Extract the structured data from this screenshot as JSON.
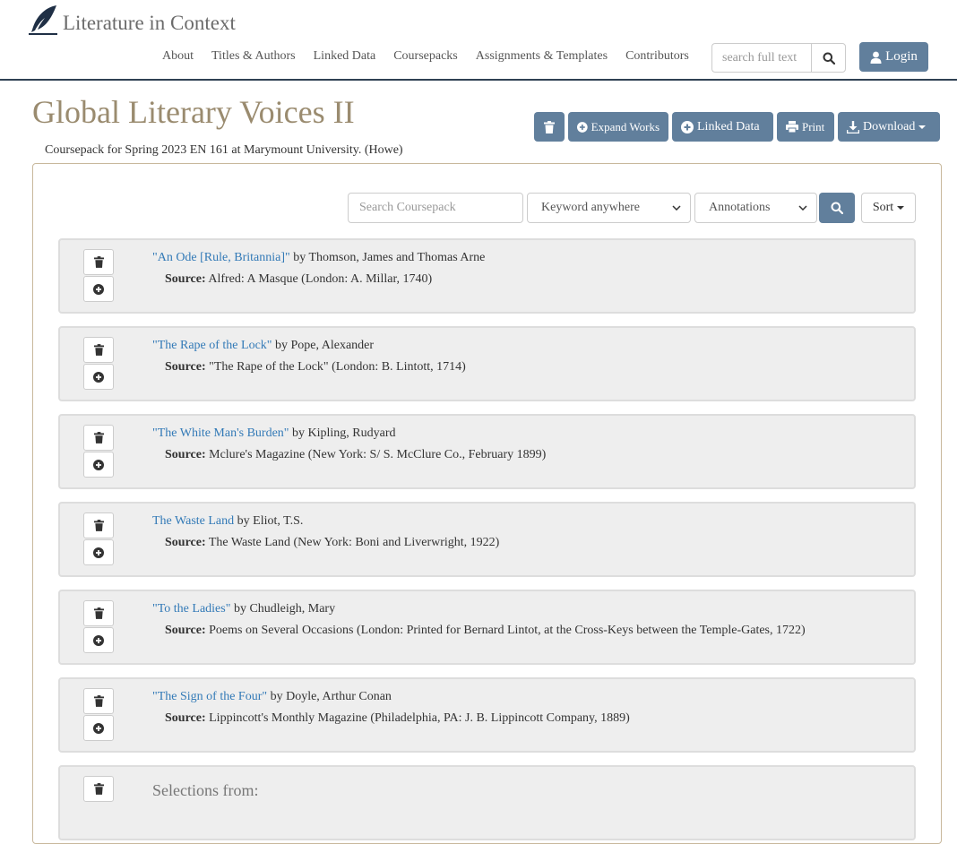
{
  "header": {
    "brand": "Literature in Context",
    "nav": [
      "About",
      "Titles & Authors",
      "Linked Data",
      "Coursepacks",
      "Assignments & Templates",
      "Contributors"
    ],
    "search_placeholder": "search full text",
    "login_label": "Login"
  },
  "coursepack": {
    "title": "Global Literary Voices II",
    "subtitle": "Coursepack for Spring 2023 EN 161 at Marymount University. (Howe)",
    "toolbar": {
      "expand_label": "Expand Works",
      "linked_label": "Linked Data",
      "print_label": "Print",
      "download_label": "Download"
    }
  },
  "search": {
    "placeholder": "Search Coursepack",
    "field_selected": "Keyword anywhere",
    "type_selected": "Annotations",
    "sort_label": "Sort"
  },
  "source_label": "Source:",
  "works": [
    {
      "title": "\"An Ode [Rule, Britannia]\"",
      "by": " by Thomson, James and Thomas Arne",
      "source": " Alfred: A Masque (London: A. Millar, 1740)"
    },
    {
      "title": "\"The Rape of the Lock\"",
      "by": " by Pope, Alexander",
      "source": " \"The Rape of the Lock\" (London: B. Lintott, 1714)"
    },
    {
      "title": "\"The White Man's Burden\"",
      "by": " by Kipling, Rudyard",
      "source": " Mclure's Magazine (New York: S/ S. McClure Co., February 1899)"
    },
    {
      "title": "The Waste Land",
      "by": " by Eliot, T.S.",
      "source": " The Waste Land (New York: Boni and Liverwright, 1922)"
    },
    {
      "title": "\"To the Ladies\"",
      "by": " by Chudleigh, Mary",
      "source": " Poems on Several Occasions (London: Printed for Bernard Lintot, at the Cross-Keys between the Temple-Gates, 1722)"
    },
    {
      "title": "\"The Sign of the Four\"",
      "by": " by Doyle, Arthur Conan",
      "source": " Lippincott's Monthly Magazine (Philadelphia, PA: J. B. Lippincott Company, 1889)"
    }
  ],
  "partial_work": {
    "title": "Selections from:"
  },
  "colors": {
    "accent": "#617f9c",
    "title": "#9a8b6f",
    "link": "#337ab7",
    "panel_border": "#c8b89c"
  },
  "icons": [
    "feather-icon",
    "search-icon",
    "user-icon",
    "trash-icon",
    "plus-circle-icon",
    "print-icon",
    "download-icon",
    "caret-down-icon"
  ]
}
